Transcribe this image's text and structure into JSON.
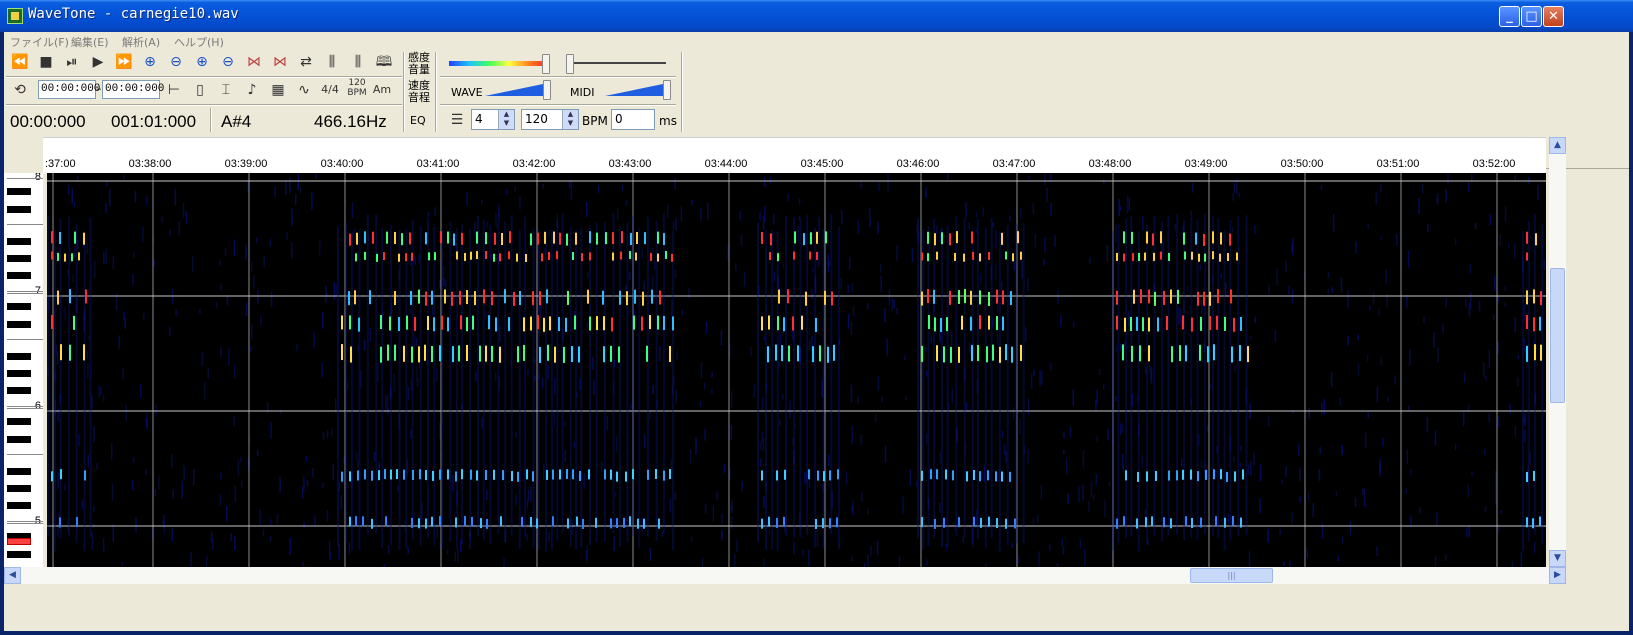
{
  "window": {
    "title": "WaveTone - carnegie10.wav",
    "controls": {
      "minimize": "_",
      "maximize": "□",
      "close": "✕"
    }
  },
  "menu": [
    "ファイル(F)",
    "編集(E)",
    "解析(A)",
    "ヘルプ(H)"
  ],
  "toolbar": {
    "row1_icons": [
      "rewind-icon",
      "stop-icon",
      "pause-icon",
      "play-icon",
      "fast-forward-icon",
      "zoom-in-time-icon",
      "zoom-out-time-icon",
      "zoom-in-pitch-icon",
      "zoom-out-pitch-icon",
      "expand-icon",
      "shrink-icon",
      "swap-icon",
      "channel-l-icon",
      "channel-c-icon",
      "book-icon"
    ],
    "row2_icons": [
      "loop-icon"
    ],
    "range_start": "00:00:000",
    "range_dash": "–",
    "range_end": "00:00:000",
    "row2_tools": [
      "marker-icon",
      "pin-icon",
      "cursor-icon",
      "note-icon",
      "grid-icon",
      "wave-icon"
    ],
    "meter": "4/4",
    "bpm_top": "120",
    "bpm_bottom": "BPM",
    "key": "Am",
    "sensitivity_top": "感度",
    "sensitivity_bottom": "音量",
    "speed_top": "速度",
    "speed_bottom": "音程",
    "wave_label": "WAVE",
    "midi_label": "MIDI",
    "eq_label": "EQ",
    "beats_value": "4",
    "bpm_value": "120",
    "bpm_unit": "BPM",
    "ms_value": "0",
    "ms_unit": "ms"
  },
  "readout": {
    "time": "00:00:000",
    "measure": "001:01:000",
    "note": "A#4",
    "frequency": "466.16Hz"
  },
  "timeline": {
    "first_label": ":37:00",
    "labels": [
      "03:38:00",
      "03:39:00",
      "03:40:00",
      "03:41:00",
      "03:42:00",
      "03:43:00",
      "03:44:00",
      "03:45:00",
      "03:46:00",
      "03:47:00",
      "03:48:00",
      "03:49:00",
      "03:50:00",
      "03:51:00",
      "03:52:00"
    ]
  },
  "piano": {
    "octave_labels": [
      "8",
      "7",
      "6",
      "5"
    ],
    "highlighted_note": "A#4"
  },
  "scroll": {
    "up": "▲",
    "down": "▼",
    "left": "◀",
    "right": "▶",
    "grip": "|||"
  }
}
